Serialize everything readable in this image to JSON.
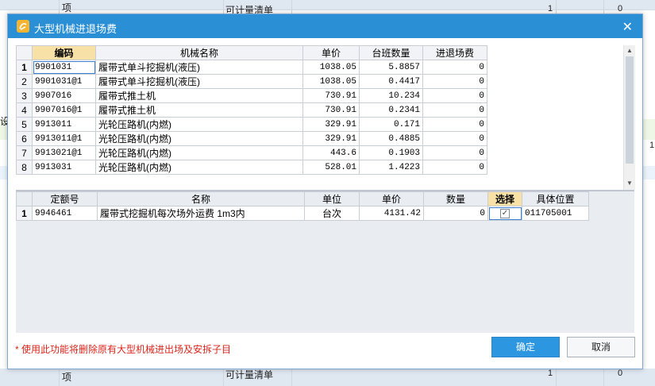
{
  "background": {
    "row_texts": [
      "项",
      "可计量清单",
      "1",
      "0",
      "设",
      "1",
      "项",
      "可计量清单",
      "1",
      "0"
    ]
  },
  "dialog": {
    "title": "大型机械进退场费",
    "close_symbol": "✕",
    "upper_table": {
      "headers": [
        "编码",
        "机械名称",
        "单价",
        "台班数量",
        "进退场费"
      ],
      "rows": [
        {
          "no": "1",
          "code": "9901031",
          "name": "履带式单斗挖掘机(液压)",
          "price": "1038.05",
          "qty": "5.8857",
          "fee": "0"
        },
        {
          "no": "2",
          "code": "9901031@1",
          "name": "履带式单斗挖掘机(液压)",
          "price": "1038.05",
          "qty": "0.4417",
          "fee": "0"
        },
        {
          "no": "3",
          "code": "9907016",
          "name": "履带式推土机",
          "price": "730.91",
          "qty": "10.234",
          "fee": "0"
        },
        {
          "no": "4",
          "code": "9907016@1",
          "name": "履带式推土机",
          "price": "730.91",
          "qty": "0.2341",
          "fee": "0"
        },
        {
          "no": "5",
          "code": "9913011",
          "name": "光轮压路机(内燃)",
          "price": "329.91",
          "qty": "0.171",
          "fee": "0"
        },
        {
          "no": "6",
          "code": "9913011@1",
          "name": "光轮压路机(内燃)",
          "price": "329.91",
          "qty": "0.4885",
          "fee": "0"
        },
        {
          "no": "7",
          "code": "9913021@1",
          "name": "光轮压路机(内燃)",
          "price": "443.6",
          "qty": "0.1903",
          "fee": "0"
        },
        {
          "no": "8",
          "code": "9913031",
          "name": "光轮压路机(内燃)",
          "price": "528.01",
          "qty": "1.4223",
          "fee": "0"
        }
      ]
    },
    "lower_table": {
      "headers": [
        "定额号",
        "名称",
        "单位",
        "单价",
        "数量",
        "选择",
        "具体位置"
      ],
      "rows": [
        {
          "no": "1",
          "code": "9946461",
          "name": "履带式挖掘机每次场外运费 1m3内",
          "unit": "台次",
          "price": "4131.42",
          "qty": "0",
          "check": "✓",
          "location": "011705001"
        }
      ]
    },
    "footer_note": "* 使用此功能将删除原有大型机械进出场及安拆子目",
    "ok_label": "确定",
    "cancel_label": "取消"
  },
  "colors": {
    "titlebar": "#2b8fd6",
    "ok_button": "#2c97e0",
    "header_highlight": "#f8e1a7",
    "note": "#d9261c"
  }
}
